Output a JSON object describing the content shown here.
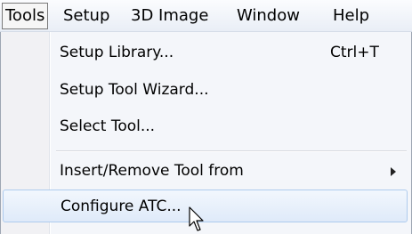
{
  "menubar": {
    "items": [
      {
        "label": "Tools",
        "active": true
      },
      {
        "label": "Setup",
        "active": false
      },
      {
        "label": "3D Image",
        "active": false
      },
      {
        "label": "Window",
        "active": false
      },
      {
        "label": "Help",
        "active": false
      }
    ]
  },
  "dropdown": {
    "items": [
      {
        "label": "Setup Library...",
        "shortcut": "Ctrl+T"
      },
      {
        "label": "Setup Tool Wizard..."
      },
      {
        "label": "Select Tool..."
      },
      {
        "label": "Insert/Remove Tool from",
        "submenu": true
      },
      {
        "label": "Configure ATC...",
        "highlighted": true
      }
    ]
  },
  "cursor": {
    "icon": "mouse-pointer-icon"
  },
  "colors": {
    "highlight_border": "#aecbee",
    "highlight_fill": "#dfeaf9",
    "menu_background": "#f4f6fa"
  }
}
